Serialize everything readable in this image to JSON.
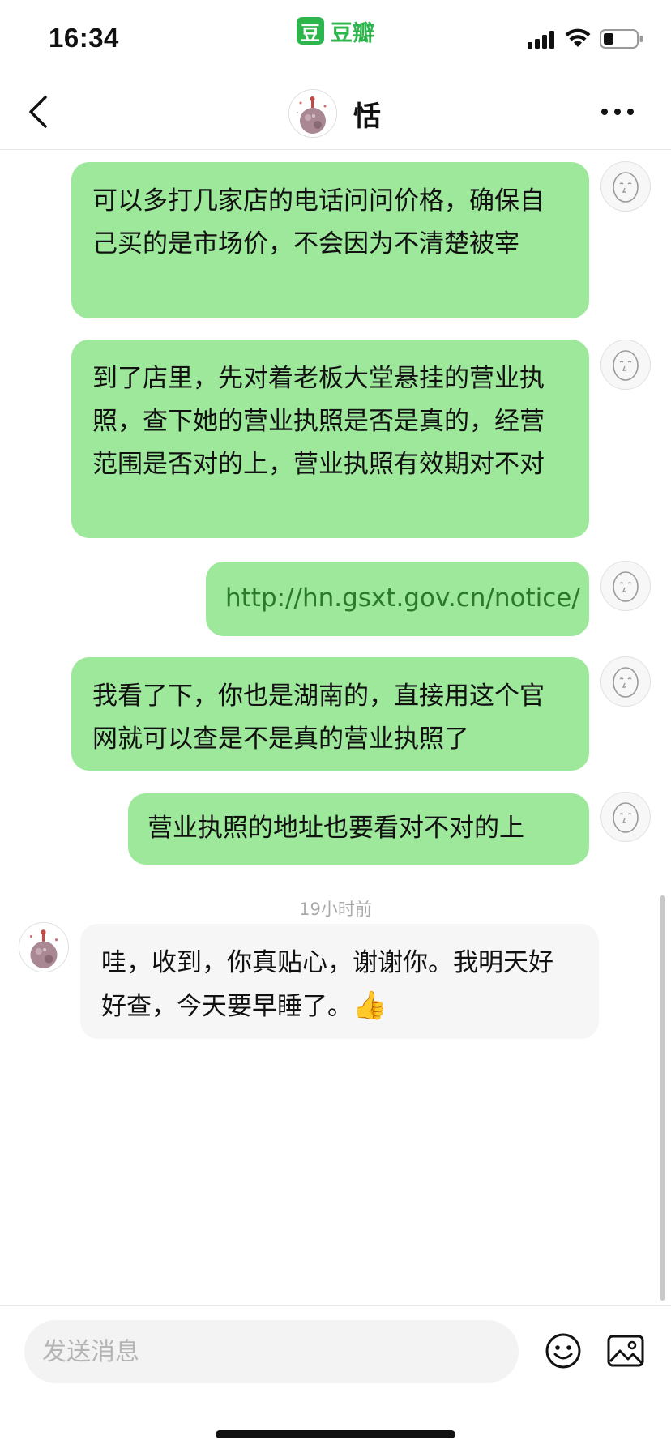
{
  "status_bar": {
    "time": "16:34",
    "app_logo_char": "豆",
    "app_name": "豆瓣"
  },
  "header": {
    "contact_name": "恬",
    "avatar_icon": "planet-avatar",
    "back_icon": "chevron-left-icon",
    "more_icon": "more-dots-icon"
  },
  "messages": [
    {
      "from": "me",
      "text": "可以多打几家店的电话问问价格，确保自己买的是市场价，不会因为不清楚被宰"
    },
    {
      "from": "me",
      "text": "到了店里，先对着老板大堂悬挂的营业执照，查下她的营业执照是否是真的，经营范围是否对的上，营业执照有效期对不对"
    },
    {
      "from": "me",
      "text": "http://hn.gsxt.gov.cn/notice/"
    },
    {
      "from": "me",
      "text": "我看了下，你也是湖南的，直接用这个官网就可以查是不是真的营业执照了"
    },
    {
      "from": "me",
      "text": "营业执照的地址也要看对不对的上"
    },
    {
      "from": "other",
      "text": "哇，收到，你真贴心，谢谢你。我明天好好查，今天要早睡了。",
      "emoji": "👍"
    }
  ],
  "timestamp": "19小时前",
  "input": {
    "placeholder": "发送消息"
  },
  "colors": {
    "outgoing_bubble": "#9de89a",
    "incoming_bubble": "#f6f6f6",
    "brand_green": "#2db64c"
  }
}
